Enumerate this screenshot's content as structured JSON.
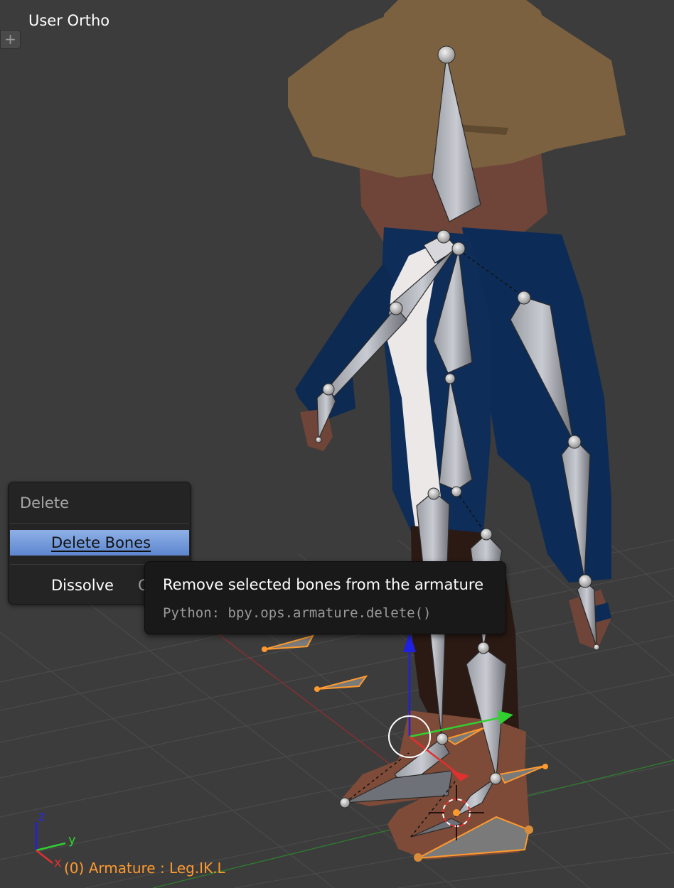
{
  "viewport": {
    "title": "User Ortho",
    "corner_widget_icon": "plus-icon",
    "active_object_label": "(0) Armature : Leg.IK.L",
    "axis_labels": {
      "x": "x",
      "y": "y",
      "z": "z"
    }
  },
  "delete_menu": {
    "title": "Delete",
    "items": [
      {
        "label": "Delete Bones",
        "shortcut": ""
      },
      {
        "label": "Dissolve",
        "shortcut": "Ctrl"
      }
    ]
  },
  "tooltip": {
    "description": "Remove selected bones from the armature",
    "python": "Python: bpy.ops.armature.delete()"
  },
  "colors": {
    "viewport_bg": "#3c3c3c",
    "selection_orange": "#ff9a2e",
    "menu_highlight": "#6e96d8",
    "axis_x": "#e03030",
    "axis_y": "#30d030",
    "axis_z": "#2020e0",
    "hat": "#7b613f",
    "jacket": "#0c2c57",
    "skin": "#6e4538"
  }
}
